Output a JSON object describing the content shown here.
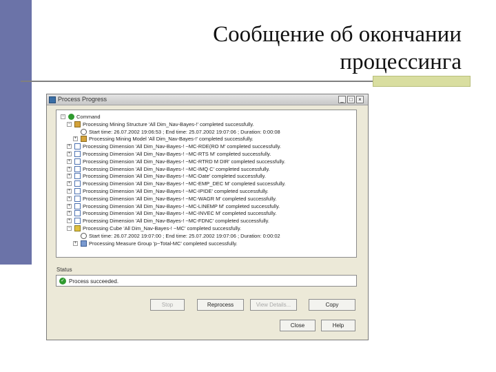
{
  "slide": {
    "title_line1": "Сообщение об окончании",
    "title_line2": "процессинга"
  },
  "window": {
    "title": "Process Progress",
    "minimize": "_",
    "maximize": "□",
    "close": "×"
  },
  "tree": [
    {
      "indent": 0,
      "expander": "−",
      "icon": "play-icon",
      "text": "Command"
    },
    {
      "indent": 1,
      "expander": "−",
      "icon": "mining-icon",
      "text": "Processing Mining Structure 'All Dim_Nav-Bayes-!' completed successfully."
    },
    {
      "indent": 2,
      "expander": "",
      "icon": "clock-icon",
      "text": "Start time: 26.07.2002 19:06:53 ; End time: 25.07.2002 19:07:06 ; Duration: 0:00:08"
    },
    {
      "indent": 2,
      "expander": "+",
      "icon": "mining-icon",
      "text": "Processing Mining Model 'All Dim_Nav-Bayes-!' completed successfully."
    },
    {
      "indent": 1,
      "expander": "+",
      "icon": "dimension-icon",
      "text": "Processing Dimension 'All Dim_Nav-Bayes-! ~MC-RDE(RO M' completed successfully."
    },
    {
      "indent": 1,
      "expander": "+",
      "icon": "dimension-icon",
      "text": "Processing Dimension 'All Dim_Nav-Bayes-! ~MC-RTS M' completed successfully."
    },
    {
      "indent": 1,
      "expander": "+",
      "icon": "dimension-icon",
      "text": "Processing Dimension 'All Dim_Nav-Bayes-! ~MC-RTRD M DIR' completed successfully."
    },
    {
      "indent": 1,
      "expander": "+",
      "icon": "dimension-icon",
      "text": "Processing Dimension 'All Dim_Nav-Bayes-! ~MC-IMQ C' completed successfully."
    },
    {
      "indent": 1,
      "expander": "+",
      "icon": "dimension-icon",
      "text": "Processing Dimension 'All Dim_Nav-Bayes-! ~MC-Date' completed successfully."
    },
    {
      "indent": 1,
      "expander": "+",
      "icon": "dimension-icon",
      "text": "Processing Dimension 'All Dim_Nav-Bayes-! ~MC-EMP_DEC M' completed successfully."
    },
    {
      "indent": 1,
      "expander": "+",
      "icon": "dimension-icon",
      "text": "Processing Dimension 'All Dim_Nav-Bayes-! ~MC-IPIDE' completed successfully."
    },
    {
      "indent": 1,
      "expander": "+",
      "icon": "dimension-icon",
      "text": "Processing Dimension 'All Dim_Nav-Bayes-! ~MC-WAGR M' completed successfully."
    },
    {
      "indent": 1,
      "expander": "+",
      "icon": "dimension-icon",
      "text": "Processing Dimension 'All Dim_Nav-Bayes-! ~MC-LINEMP M' completed successfully."
    },
    {
      "indent": 1,
      "expander": "+",
      "icon": "dimension-icon",
      "text": "Processing Dimension 'All Dim_Nav-Bayes-! ~MC-INVEC M' completed successfully."
    },
    {
      "indent": 1,
      "expander": "+",
      "icon": "dimension-icon",
      "text": "Processing Dimension 'All Dim_Nav-Bayes-! ~MC-FDNC' completed successfully."
    },
    {
      "indent": 1,
      "expander": "−",
      "icon": "cube-icon",
      "text": "Processing Cube 'All Dim_Nav-Bayes-! ~MC' completed successfully."
    },
    {
      "indent": 2,
      "expander": "",
      "icon": "clock-icon",
      "text": "Start time: 26.07.2002 19:07:00 ; End time: 25.07.2002 19:07:06 ; Duration: 0:00:02"
    },
    {
      "indent": 2,
      "expander": "+",
      "icon": "measure-icon",
      "text": "Processing Measure Group 'p~Total-MC' completed successfully."
    }
  ],
  "status": {
    "label": "Status",
    "text": "Process succeeded."
  },
  "buttons": {
    "stop": "Stop",
    "reprocess": "Reprocess",
    "view_details": "View Details...",
    "copy": "Copy",
    "close": "Close",
    "help": "Help"
  }
}
